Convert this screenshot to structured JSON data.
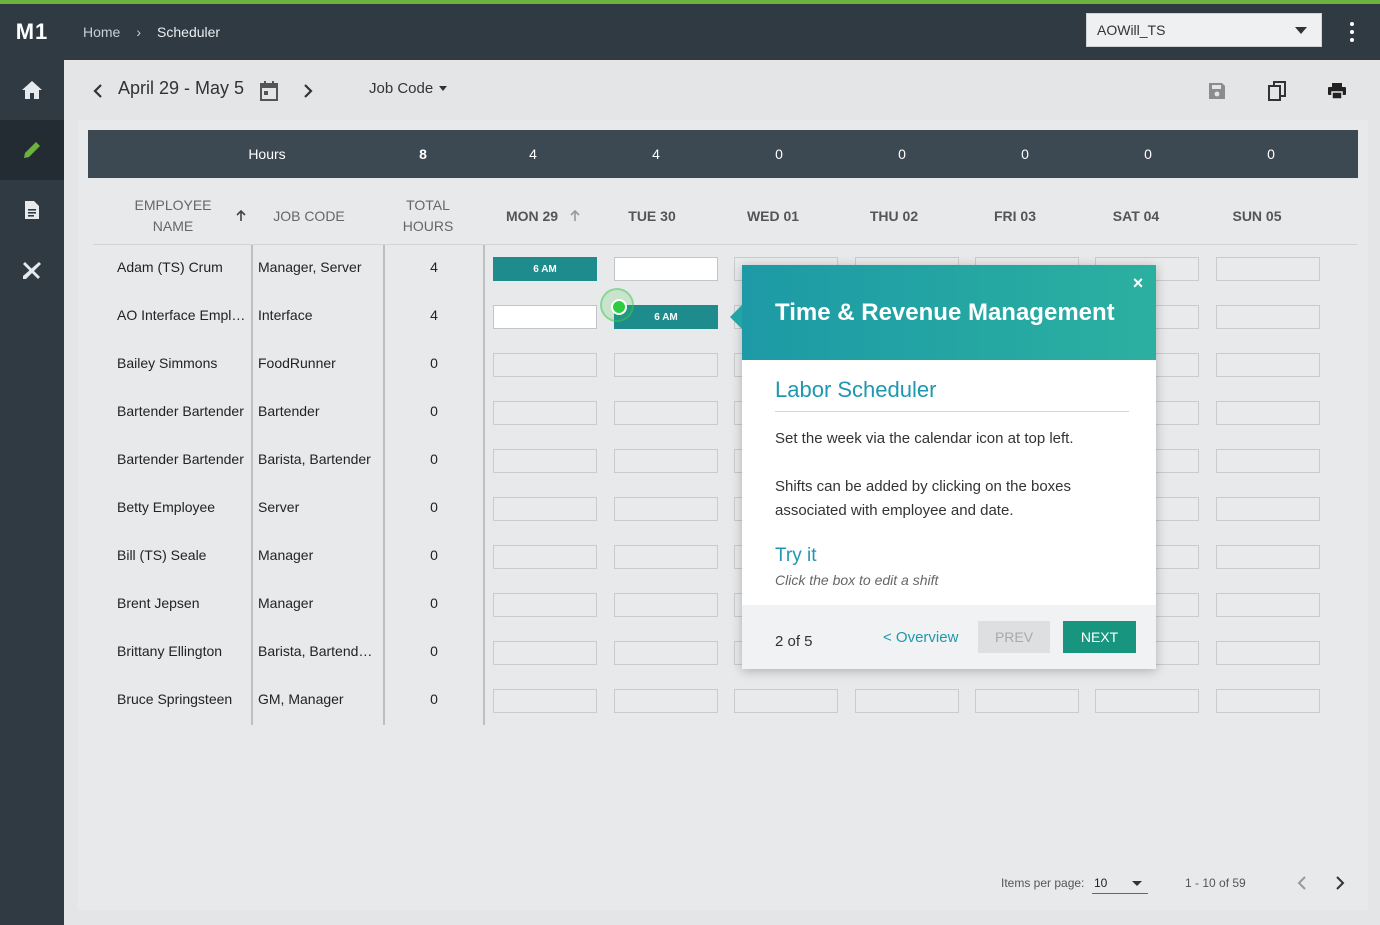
{
  "app": {
    "logo": "M1"
  },
  "breadcrumb": {
    "home": "Home",
    "current": "Scheduler"
  },
  "location_select": {
    "value": "AOWill_TS"
  },
  "sidebar": {
    "items": [
      {
        "icon": "home-icon"
      },
      {
        "icon": "pencil-icon",
        "active": true
      },
      {
        "icon": "document-icon"
      },
      {
        "icon": "tools-icon"
      }
    ]
  },
  "toolbar": {
    "date_range": "April 29 - May 5",
    "group_by": "Job Code"
  },
  "hours_row": {
    "label": "Hours",
    "total": "8",
    "days": [
      "4",
      "4",
      "0",
      "0",
      "0",
      "0",
      "0"
    ]
  },
  "columns": {
    "employee": [
      "EMPLOYEE",
      "NAME"
    ],
    "job_code": "JOB CODE",
    "total": [
      "TOTAL",
      "HOURS"
    ],
    "days": [
      "MON 29",
      "TUE 30",
      "WED 01",
      "THU 02",
      "FRI 03",
      "SAT 04",
      "SUN 05"
    ]
  },
  "rows": [
    {
      "name": "Adam (TS) Crum",
      "job": "Manager, Server",
      "total": "4",
      "shifts": {
        "0": "6 AM"
      },
      "white": [
        1
      ]
    },
    {
      "name": "AO Interface Employee",
      "job": "Interface",
      "total": "4",
      "shifts": {
        "1": "6 AM"
      },
      "white": [
        0
      ]
    },
    {
      "name": "Bailey Simmons",
      "job": "FoodRunner",
      "total": "0"
    },
    {
      "name": "Bartender Bartender",
      "job": "Bartender",
      "total": "0"
    },
    {
      "name": "Bartender Bartender",
      "job": "Barista, Bartender",
      "total": "0"
    },
    {
      "name": "Betty Employee",
      "job": "Server",
      "total": "0"
    },
    {
      "name": "Bill (TS) Seale",
      "job": "Manager",
      "total": "0"
    },
    {
      "name": "Brent Jepsen",
      "job": "Manager",
      "total": "0"
    },
    {
      "name": "Brittany Ellington",
      "job": "Barista, Bartender, Server",
      "total": "0"
    },
    {
      "name": "Bruce Springsteen",
      "job": "GM, Manager",
      "total": "0"
    }
  ],
  "pager": {
    "items_label": "Items per page:",
    "items_value": "10",
    "range": "1 - 10 of 59"
  },
  "tour": {
    "title": "Time & Revenue Management",
    "subtitle": "Labor Scheduler",
    "p1": "Set the week via the calendar icon at top left.",
    "p2": "Shifts can be added by clicking on the boxes associated with employee and date.",
    "try": "Try it",
    "hint": "Click the box to edit a shift",
    "step": "2 of 5",
    "overview": "< Overview",
    "prev": "PREV",
    "next": "NEXT",
    "close": "×"
  }
}
